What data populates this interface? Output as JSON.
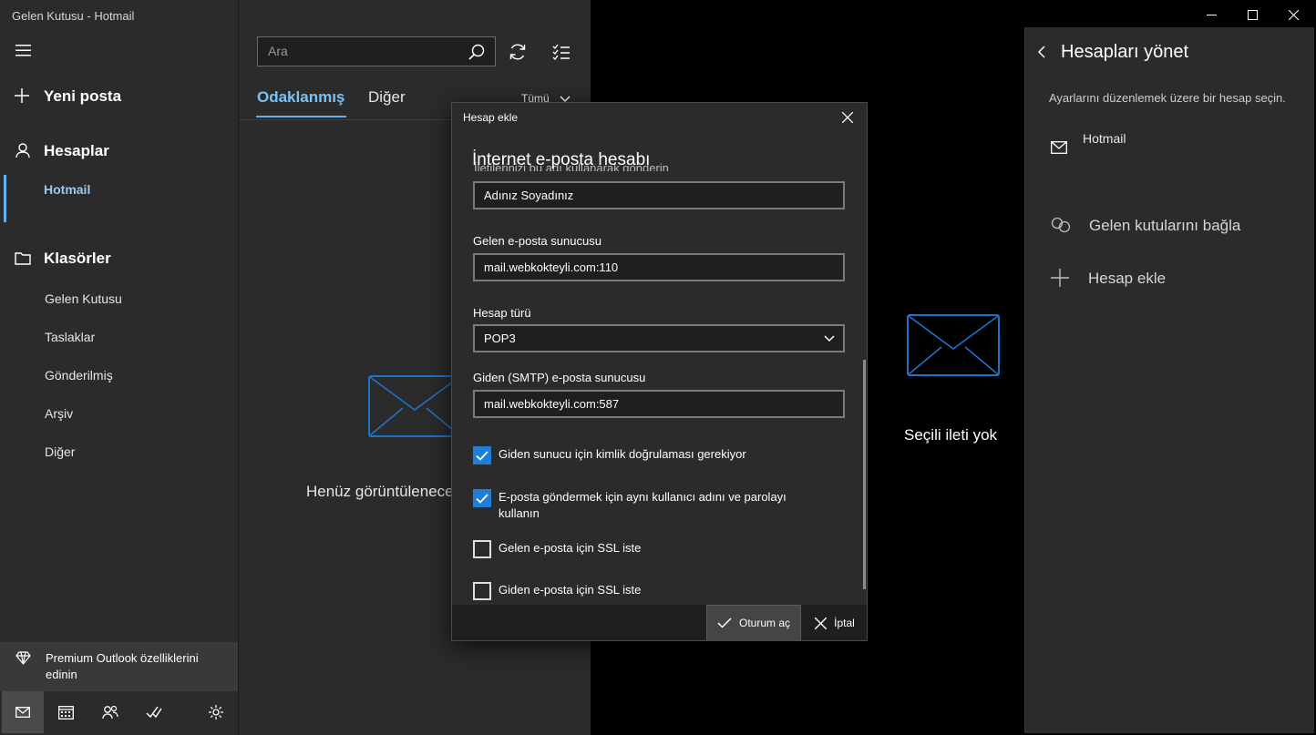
{
  "window": {
    "title": "Gelen Kutusu - Hotmail"
  },
  "sidebar": {
    "new_mail": "Yeni posta",
    "accounts_header": "Hesaplar",
    "account": "Hotmail",
    "folders_header": "Klasörler",
    "folders": [
      "Gelen Kutusu",
      "Taslaklar",
      "Gönderilmiş",
      "Arşiv",
      "Diğer"
    ],
    "premium": "Premium Outlook özelliklerini edinin"
  },
  "list": {
    "search_placeholder": "Ara",
    "tab_focused": "Odaklanmış",
    "tab_other": "Diğer",
    "filter": "Tümü",
    "empty_text": "Henüz görüntülenecek"
  },
  "reading": {
    "no_message": "Seçili ileti yok"
  },
  "manage": {
    "title": "Hesapları yönet",
    "subtitle": "Ayarlarını düzenlemek üzere bir hesap seçin.",
    "account": "Hotmail",
    "link_inboxes": "Gelen kutularını bağla",
    "add_account": "Hesap ekle"
  },
  "dialog": {
    "caption": "Hesap ekle",
    "heading": "İnternet e-posta hesabı",
    "clipped_label": "İletilerinizi bu adı kullanarak gönderin",
    "name_value": "Adınız Soyadınız",
    "incoming_label": "Gelen e-posta sunucusu",
    "incoming_value": "mail.webkokteyli.com:110",
    "type_label": "Hesap türü",
    "type_value": "POP3",
    "outgoing_label": "Giden (SMTP) e-posta sunucusu",
    "outgoing_value": "mail.webkokteyli.com:587",
    "chk_auth": "Giden sunucu için kimlik doğrulaması gerekiyor",
    "chk_same": "E-posta göndermek için aynı kullanıcı adını ve parolayı kullanın",
    "chk_ssl_in": "Gelen e-posta için SSL iste",
    "chk_ssl_out": "Giden e-posta için SSL iste",
    "signin": "Oturum aç",
    "cancel": "İptal"
  },
  "colors": {
    "accent": "#1f7fd6",
    "accent_text": "#7cc0f4"
  }
}
